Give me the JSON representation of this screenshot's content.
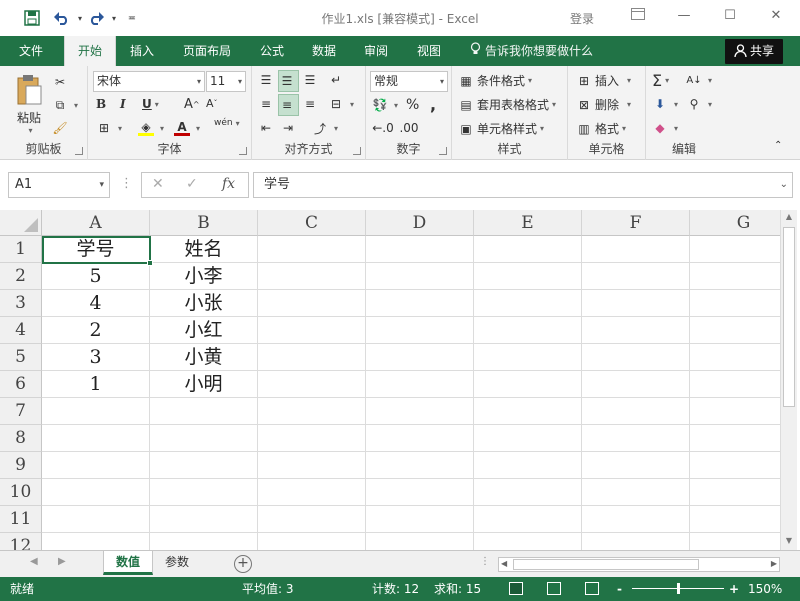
{
  "titlebar": {
    "doc_title": "作业1.xls  [兼容模式]  -  Excel",
    "login": "登录",
    "quick_access": [
      "save-icon",
      "undo-icon",
      "redo-icon",
      "customize-icon"
    ]
  },
  "tabs": {
    "file": "文件",
    "items": [
      "开始",
      "插入",
      "页面布局",
      "公式",
      "数据",
      "审阅",
      "视图"
    ],
    "active": "开始",
    "tell_me": "告诉我你想要做什么",
    "share": "共享"
  },
  "ribbon": {
    "clipboard": {
      "label": "剪贴板",
      "paste": "粘贴"
    },
    "font": {
      "label": "字体",
      "font_name": "宋体",
      "font_size": "11",
      "bold": "B",
      "italic": "I",
      "underline": "U",
      "grow": "A",
      "shrink": "A",
      "phonetic": "wén"
    },
    "alignment": {
      "label": "对齐方式"
    },
    "number": {
      "label": "数字",
      "format": "常规",
      "percent": "%",
      "comma": ","
    },
    "styles": {
      "label": "样式",
      "conditional": "条件格式",
      "table": "套用表格格式",
      "cell_styles": "单元格样式"
    },
    "cells": {
      "label": "单元格",
      "insert": "插入",
      "delete": "删除",
      "format": "格式"
    },
    "editing": {
      "label": "编辑"
    }
  },
  "formula_bar": {
    "name_box": "A1",
    "content": "学号",
    "cancel": "✕",
    "enter": "✓",
    "fx": "fx"
  },
  "sheet": {
    "columns": [
      "A",
      "B",
      "C",
      "D",
      "E",
      "F",
      "G"
    ],
    "rows": [
      "1",
      "2",
      "3",
      "4",
      "5",
      "6",
      "7",
      "8",
      "9",
      "10",
      "11",
      "12"
    ],
    "cells": [
      [
        "学号",
        "姓名"
      ],
      [
        "5",
        "小李"
      ],
      [
        "4",
        "小张"
      ],
      [
        "2",
        "小红"
      ],
      [
        "3",
        "小黄"
      ],
      [
        "1",
        "小明"
      ]
    ]
  },
  "sheet_tabs": {
    "tabs": [
      "数值",
      "参数"
    ],
    "active": "数值"
  },
  "statusbar": {
    "ready": "就绪",
    "average": "平均值: 3",
    "count": "计数: 12",
    "sum": "求和: 15",
    "zoom": "150%",
    "zoom_minus": "-",
    "zoom_plus": "+",
    "zoom_fraction": 0.5
  },
  "colors": {
    "accent": "#217346",
    "ribbon_bg": "#f3f3f3"
  }
}
